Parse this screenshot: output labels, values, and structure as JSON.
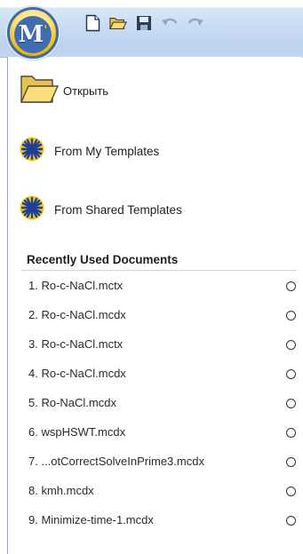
{
  "app_button": {
    "letter": "M",
    "mark": "'"
  },
  "quick_access": [
    {
      "name": "new-document-icon"
    },
    {
      "name": "open-folder-icon"
    },
    {
      "name": "save-icon"
    },
    {
      "name": "undo-icon"
    },
    {
      "name": "redo-icon"
    }
  ],
  "commands": {
    "open": "Открыть",
    "my_templates": "From My Templates",
    "shared_templates": "From Shared Templates"
  },
  "recent": {
    "header": "Recently Used Documents",
    "items": [
      "1. Ro-c-NaCl.mctx",
      "2. Ro-c-NaCl.mcdx",
      "3. Ro-c-NaCl.mctx",
      "4. Ro-c-NaCl.mcdx",
      "5. Ro-NaCl.mcdx",
      "6. wspHSWT.mcdx",
      "7. ...otCorrectSolveInPrime3.mcdx",
      "8. kmh.mcdx",
      "9. Minimize-time-1.mcdx"
    ]
  },
  "colors": {
    "titlebar": "#c9dcf3",
    "accent_blue": "#3f6db0",
    "accent_yellow": "#f5c400"
  }
}
